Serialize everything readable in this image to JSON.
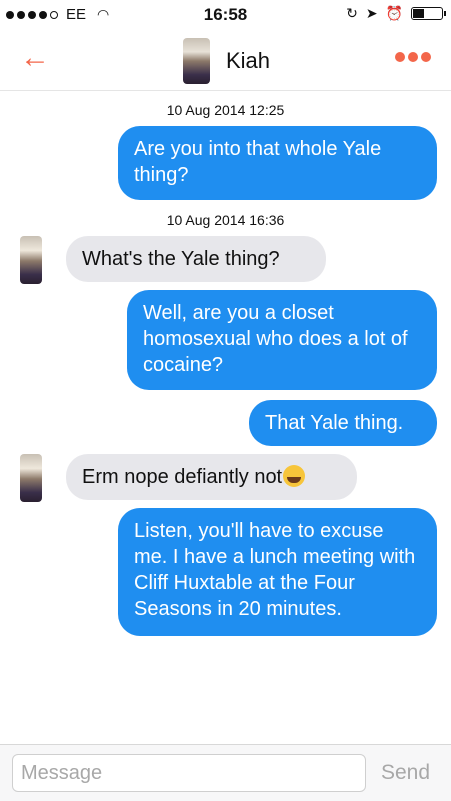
{
  "status": {
    "carrier": "EE",
    "time": "16:58"
  },
  "header": {
    "contact_name": "Kiah"
  },
  "conversation": [
    {
      "type": "timestamp",
      "text": "10 Aug 2014 12:25"
    },
    {
      "type": "outgoing",
      "text": "Are you into that whole Yale thing?"
    },
    {
      "type": "timestamp",
      "text": "10 Aug 2014 16:36"
    },
    {
      "type": "incoming",
      "text": "What's the Yale thing?"
    },
    {
      "type": "outgoing",
      "text": "Well, are you a closet homosexual who does a lot of cocaine?"
    },
    {
      "type": "outgoing",
      "text": "That Yale thing."
    },
    {
      "type": "incoming",
      "text": "Erm nope defiantly not",
      "emoji": "face-with-tears-of-joy"
    },
    {
      "type": "outgoing",
      "text": "Listen, you'll have to excuse me. I have a lunch meeting with Cliff Huxtable at the Four Seasons in 20 minutes."
    }
  ],
  "composer": {
    "placeholder": "Message",
    "value": "",
    "send_label": "Send"
  },
  "colors": {
    "accent": "#f3664a",
    "outgoing_bubble": "#1f8ef0",
    "incoming_bubble": "#e7e7eb"
  }
}
